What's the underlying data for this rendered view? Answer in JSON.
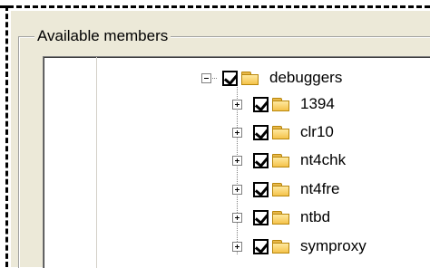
{
  "group": {
    "title": "Available members"
  },
  "tree": {
    "root": {
      "label": "debuggers",
      "checked": true,
      "expanded": true,
      "icon": "folder-icon"
    },
    "children": [
      {
        "label": "1394",
        "checked": true,
        "expanded": false,
        "icon": "folder-icon"
      },
      {
        "label": "clr10",
        "checked": true,
        "expanded": false,
        "icon": "folder-icon"
      },
      {
        "label": "nt4chk",
        "checked": true,
        "expanded": false,
        "icon": "folder-icon"
      },
      {
        "label": "nt4fre",
        "checked": true,
        "expanded": false,
        "icon": "folder-icon"
      },
      {
        "label": "ntbd",
        "checked": true,
        "expanded": false,
        "icon": "folder-icon"
      },
      {
        "label": "symproxy",
        "checked": true,
        "expanded": false,
        "icon": "folder-icon"
      }
    ]
  },
  "colors": {
    "panel": "#ece9d8",
    "folder": "#f4c24a",
    "tree_bg": "#ffffff"
  }
}
